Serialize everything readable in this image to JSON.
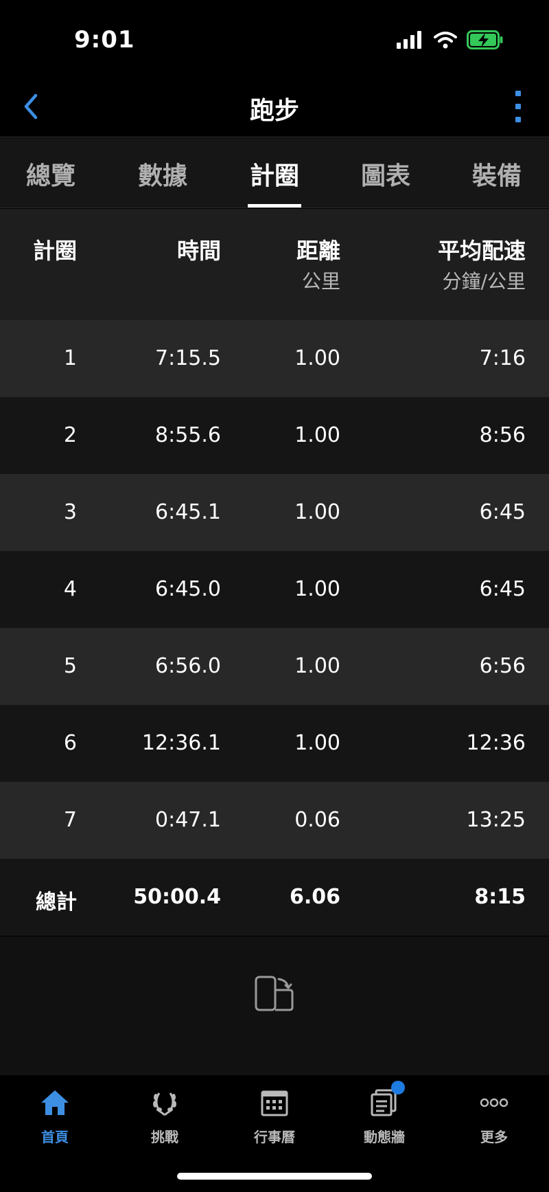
{
  "status_bar": {
    "time": "9:01"
  },
  "header": {
    "title": "跑步"
  },
  "tabs": [
    {
      "label": "總覽",
      "active": false
    },
    {
      "label": "數據",
      "active": false
    },
    {
      "label": "計圈",
      "active": true
    },
    {
      "label": "圖表",
      "active": false
    },
    {
      "label": "裝備",
      "active": false
    }
  ],
  "table": {
    "columns": [
      {
        "label": "計圈",
        "unit": ""
      },
      {
        "label": "時間",
        "unit": ""
      },
      {
        "label": "距離",
        "unit": "公里"
      },
      {
        "label": "平均配速",
        "unit": "分鐘/公里"
      }
    ],
    "rows": [
      {
        "lap": "1",
        "time": "7:15.5",
        "distance": "1.00",
        "pace": "7:16"
      },
      {
        "lap": "2",
        "time": "8:55.6",
        "distance": "1.00",
        "pace": "8:56"
      },
      {
        "lap": "3",
        "time": "6:45.1",
        "distance": "1.00",
        "pace": "6:45"
      },
      {
        "lap": "4",
        "time": "6:45.0",
        "distance": "1.00",
        "pace": "6:45"
      },
      {
        "lap": "5",
        "time": "6:56.0",
        "distance": "1.00",
        "pace": "6:56"
      },
      {
        "lap": "6",
        "time": "12:36.1",
        "distance": "1.00",
        "pace": "12:36"
      },
      {
        "lap": "7",
        "time": "0:47.1",
        "distance": "0.06",
        "pace": "13:25"
      }
    ],
    "total": {
      "label": "總計",
      "time": "50:00.4",
      "distance": "6.06",
      "pace": "8:15"
    }
  },
  "bottom_nav": [
    {
      "label": "首頁",
      "icon": "home-icon",
      "active": true
    },
    {
      "label": "挑戰",
      "icon": "laurel-icon",
      "active": false
    },
    {
      "label": "行事曆",
      "icon": "calendar-icon",
      "active": false
    },
    {
      "label": "動態牆",
      "icon": "newsfeed-icon",
      "active": false,
      "badge": true
    },
    {
      "label": "更多",
      "icon": "more-icon",
      "active": false
    }
  ],
  "colors": {
    "accent": "#3d8fe4",
    "badge": "#1e7be0",
    "battery": "#34c759"
  }
}
